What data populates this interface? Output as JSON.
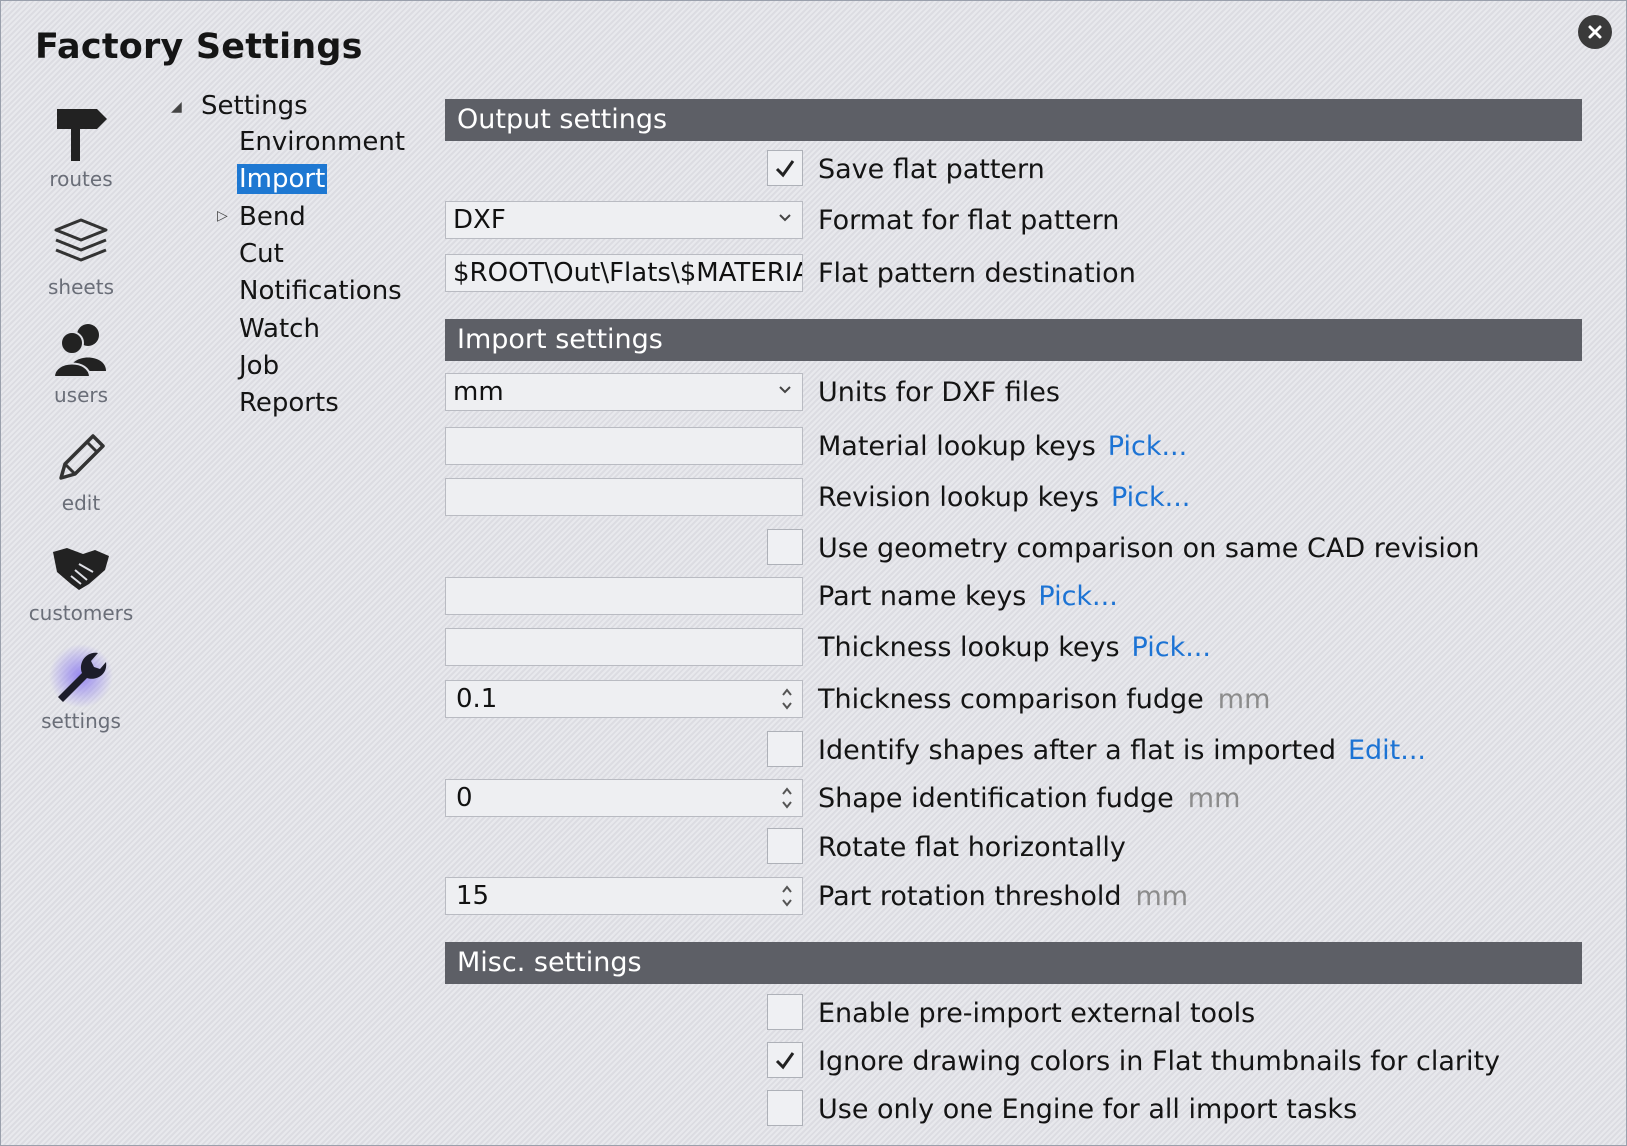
{
  "window": {
    "title": "Factory Settings",
    "close_icon": "close-icon"
  },
  "nav": [
    {
      "label": "routes",
      "icon": "signpost-icon"
    },
    {
      "label": "sheets",
      "icon": "layers-icon"
    },
    {
      "label": "users",
      "icon": "users-icon"
    },
    {
      "label": "edit",
      "icon": "pencil-icon"
    },
    {
      "label": "customers",
      "icon": "handshake-icon"
    },
    {
      "label": "settings",
      "icon": "wrench-icon",
      "active": true
    }
  ],
  "tree": {
    "root": "Settings",
    "items": [
      "Environment",
      "Import",
      "Bend",
      "Cut",
      "Notifications",
      "Watch",
      "Job",
      "Reports"
    ],
    "selected": "Import"
  },
  "sections": {
    "output": {
      "header": "Output settings",
      "save_flat": {
        "label": "Save flat pattern",
        "checked": true
      },
      "format": {
        "value": "DXF",
        "label": "Format for flat pattern"
      },
      "destination": {
        "value": "$ROOT\\Out\\Flats\\$MATERIAL",
        "label": "Flat pattern destination"
      }
    },
    "import": {
      "header": "Import settings",
      "units": {
        "value": "mm",
        "label": "Units for DXF files"
      },
      "material_keys": {
        "value": "",
        "label": "Material lookup keys",
        "link": "Pick..."
      },
      "revision_keys": {
        "value": "",
        "label": "Revision lookup keys",
        "link": "Pick..."
      },
      "geometry_compare": {
        "label": "Use geometry comparison on same CAD revision",
        "checked": false
      },
      "part_name_keys": {
        "value": "",
        "label": "Part name keys",
        "link": "Pick..."
      },
      "thickness_keys": {
        "value": "",
        "label": "Thickness lookup keys",
        "link": "Pick..."
      },
      "thickness_fudge": {
        "value": "0.1",
        "label": "Thickness comparison fudge",
        "unit": "mm"
      },
      "identify_shapes": {
        "label": "Identify shapes after a flat is imported",
        "link": "Edit...",
        "checked": false
      },
      "shape_fudge": {
        "value": "0",
        "label": "Shape identification fudge",
        "unit": "mm"
      },
      "rotate_flat": {
        "label": "Rotate flat horizontally",
        "checked": false
      },
      "rotation_threshold": {
        "value": "15",
        "label": "Part rotation threshold",
        "unit": "mm"
      }
    },
    "misc": {
      "header": "Misc. settings",
      "pre_import": {
        "label": "Enable pre-import external tools",
        "checked": false
      },
      "ignore_colors": {
        "label": "Ignore drawing colors in Flat thumbnails for clarity",
        "checked": true
      },
      "one_engine": {
        "label": "Use only one Engine for all import tasks",
        "checked": false
      }
    }
  },
  "colors": {
    "accent": "#1e78d2",
    "link": "#1c73d4",
    "section_header": "#5d5f66",
    "active_glow": "#7b68ee"
  }
}
